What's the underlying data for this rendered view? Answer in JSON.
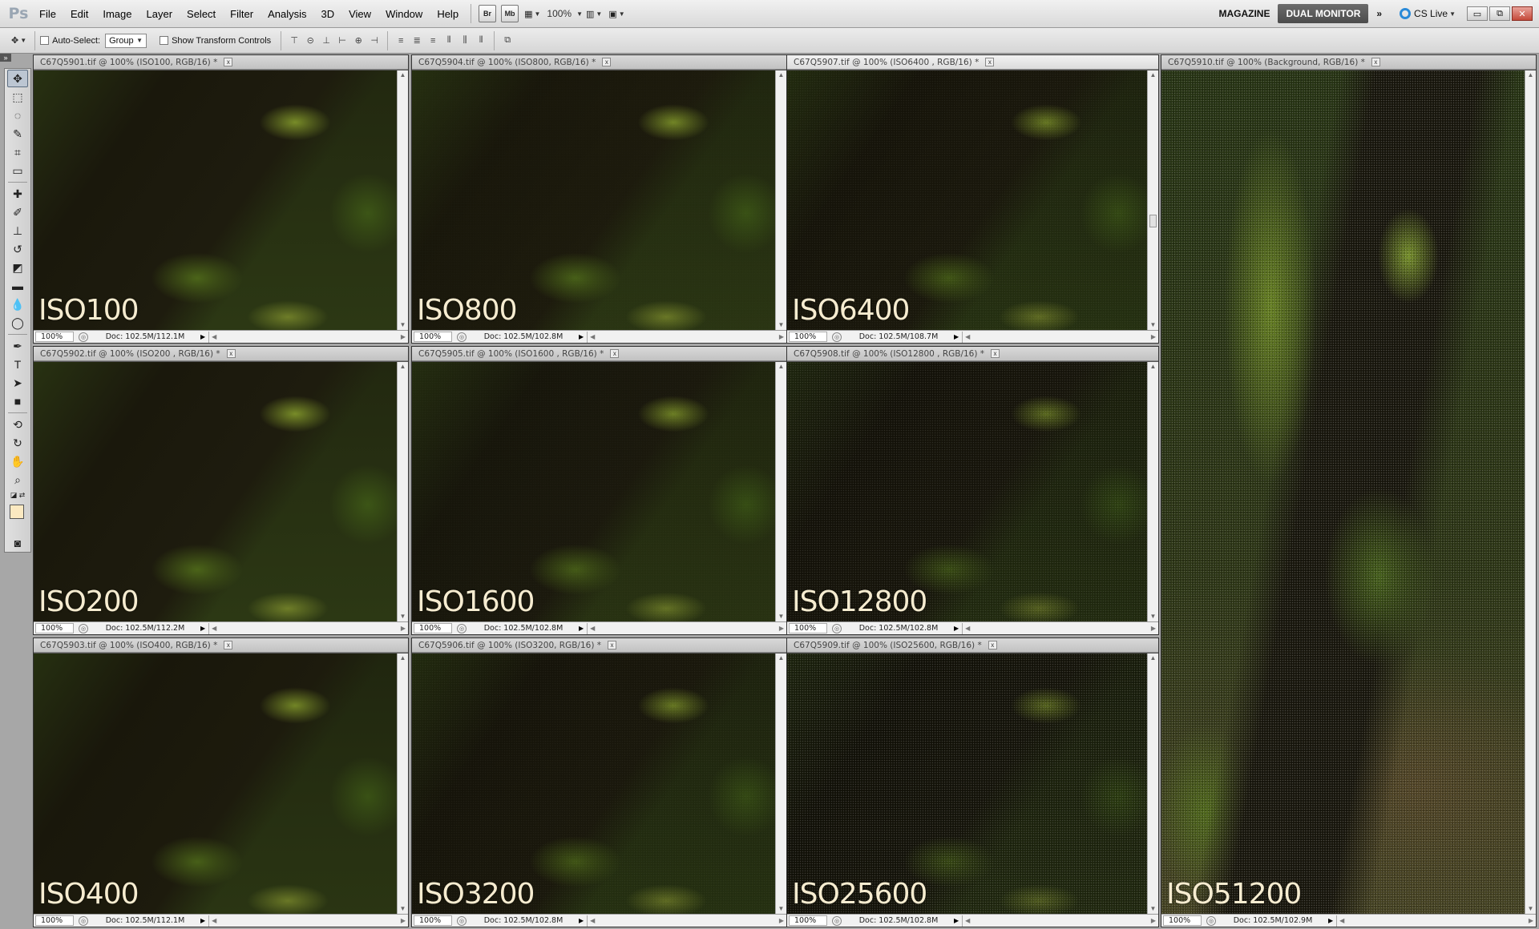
{
  "menubar": {
    "logo": "Ps",
    "items": [
      "File",
      "Edit",
      "Image",
      "Layer",
      "Select",
      "Filter",
      "Analysis",
      "3D",
      "View",
      "Window",
      "Help"
    ],
    "bridge_label": "Br",
    "minibridge_label": "Mb",
    "zoom": "100%",
    "workspaces": {
      "magazine": "MAGAZINE",
      "dual_monitor": "DUAL MONITOR"
    },
    "more_label": "»",
    "cslive": "CS Live",
    "window_buttons": {
      "minimize": "▭",
      "restore": "⧉",
      "close": "✕"
    }
  },
  "options": {
    "auto_select_label": "Auto-Select:",
    "auto_select_value": "Group",
    "transform_label": "Show Transform Controls"
  },
  "documents": [
    {
      "title": "C67Q5901.tif @ 100% (ISO100, RGB/16) *",
      "iso": "ISO100",
      "zoom": "100%",
      "doc": "Doc: 102.5M/112.1M"
    },
    {
      "title": "C67Q5904.tif @ 100% (ISO800, RGB/16) *",
      "iso": "ISO800",
      "zoom": "100%",
      "doc": "Doc: 102.5M/102.8M"
    },
    {
      "title": "C67Q5907.tif @ 100% (ISO6400 , RGB/16) *",
      "iso": "ISO6400",
      "zoom": "100%",
      "doc": "Doc: 102.5M/108.7M"
    },
    {
      "title": "C67Q5902.tif @ 100% (ISO200 , RGB/16) *",
      "iso": "ISO200",
      "zoom": "100%",
      "doc": "Doc: 102.5M/112.2M"
    },
    {
      "title": "C67Q5905.tif @ 100% (ISO1600 , RGB/16) *",
      "iso": "ISO1600",
      "zoom": "100%",
      "doc": "Doc: 102.5M/102.8M"
    },
    {
      "title": "C67Q5908.tif @ 100% (ISO12800 , RGB/16) *",
      "iso": "ISO12800",
      "zoom": "100%",
      "doc": "Doc: 102.5M/102.8M"
    },
    {
      "title": "C67Q5903.tif @ 100% (ISO400, RGB/16) *",
      "iso": "ISO400",
      "zoom": "100%",
      "doc": "Doc: 102.5M/112.1M"
    },
    {
      "title": "C67Q5906.tif @ 100% (ISO3200, RGB/16) *",
      "iso": "ISO3200",
      "zoom": "100%",
      "doc": "Doc: 102.5M/102.8M"
    },
    {
      "title": "C67Q5909.tif @ 100% (ISO25600, RGB/16) *",
      "iso": "ISO25600",
      "zoom": "100%",
      "doc": "Doc: 102.5M/102.8M"
    },
    {
      "title": "C67Q5910.tif @ 100% (Background, RGB/16) *",
      "iso": "ISO51200",
      "zoom": "100%",
      "doc": "Doc: 102.5M/102.9M"
    }
  ],
  "colors": {
    "moss": "#4a5a1e",
    "bark": "#1f1c10",
    "label": "#f6ecd0"
  }
}
